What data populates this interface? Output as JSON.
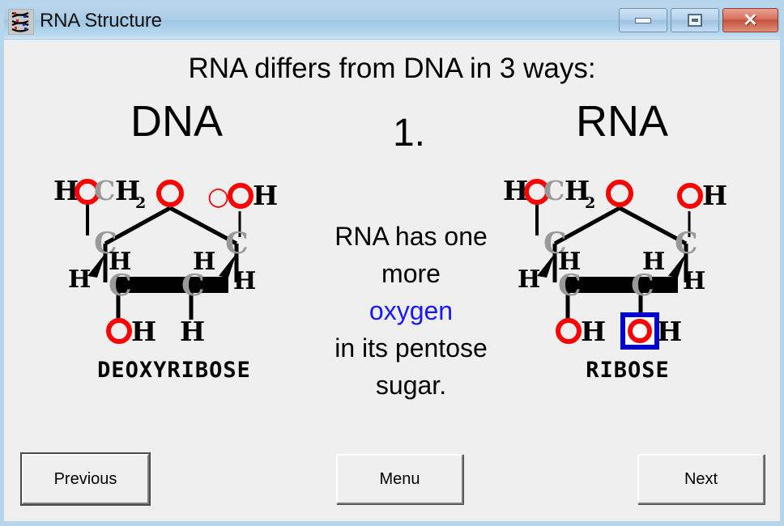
{
  "window": {
    "title": "RNA Structure",
    "icon": "dna-helix-icon",
    "controls": {
      "minimize": "minimize-icon",
      "maximize": "maximize-icon",
      "close": "✕"
    }
  },
  "content": {
    "heading": "RNA differs from DNA in 3 ways:",
    "step_number": "1.",
    "left_title": "DNA",
    "right_title": "RNA",
    "left_caption": "DEOXYRIBOSE",
    "right_caption": "RIBOSE",
    "explanation": {
      "line1": "RNA has one",
      "line2": "more",
      "highlight": "oxygen",
      "line3": "in its pentose",
      "line4": "sugar."
    },
    "highlight_color": "#1818ff"
  },
  "diagram": {
    "oxygen_color": "#ff0000",
    "carbon_color": "#999999",
    "hydrogen_color": "#000000",
    "highlight_box_color": "#0000cc",
    "deoxyribose": {
      "ring_oxygen": "O",
      "top_left_group": "HOCH",
      "top_left_subscript": "2",
      "c_left": "C",
      "c_right": "C",
      "c_bottom_left": "C",
      "c_bottom_right": "C",
      "oh_right": "OH",
      "h_upper_left": "H",
      "h_upper_left_2": "H",
      "h_upper_right": "H",
      "h_upper_right_2": "H",
      "bottom_left_group": "OH",
      "bottom_right_group": "H"
    },
    "ribose": {
      "ring_oxygen": "O",
      "top_left_group": "HOCH",
      "top_left_subscript": "2",
      "c_left": "C",
      "c_right": "C",
      "c_bottom_left": "C",
      "c_bottom_right": "C",
      "oh_right": "OH",
      "h_upper_left": "H",
      "h_upper_left_2": "H",
      "h_upper_right": "H",
      "h_upper_right_2": "H",
      "bottom_left_group": "OH",
      "bottom_right_o": "O",
      "bottom_right_h": "H"
    }
  },
  "footer": {
    "previous_label": "Previous",
    "menu_label": "Menu",
    "next_label": "Next"
  }
}
